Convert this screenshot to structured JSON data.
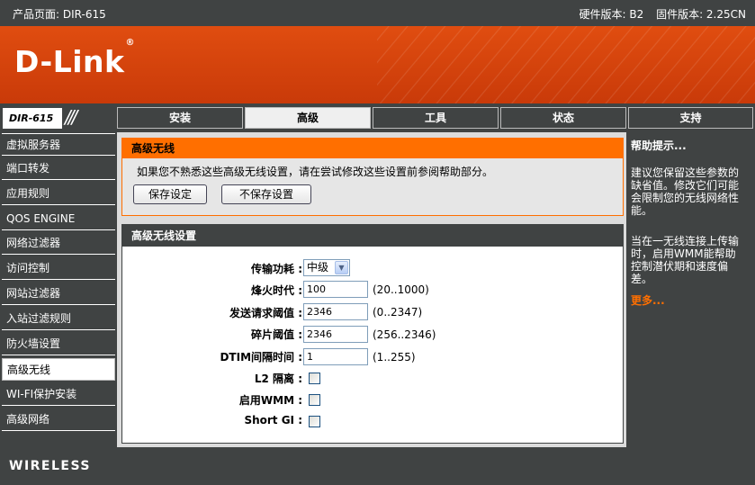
{
  "topbar": {
    "product": "产品页面: DIR-615",
    "hw": "硬件版本: B2",
    "fw": "固件版本: 2.25CN"
  },
  "brand": {
    "logo": "D-Link",
    "model": "DIR-615"
  },
  "tabs": [
    {
      "label": "安装"
    },
    {
      "label": "高级"
    },
    {
      "label": "工具"
    },
    {
      "label": "状态"
    },
    {
      "label": "支持"
    }
  ],
  "sidebar": {
    "items": [
      {
        "label": "虚拟服务器"
      },
      {
        "label": "端口转发"
      },
      {
        "label": "应用规则"
      },
      {
        "label": "QOS ENGINE"
      },
      {
        "label": "网络过滤器"
      },
      {
        "label": "访问控制"
      },
      {
        "label": "网站过滤器"
      },
      {
        "label": "入站过滤规则"
      },
      {
        "label": "防火墙设置"
      },
      {
        "label": "高级无线"
      },
      {
        "label": "WI-FI保护安装"
      },
      {
        "label": "高级网络"
      }
    ]
  },
  "advanced_wireless": {
    "title": "高级无线",
    "description": "如果您不熟悉这些高级无线设置，请在尝试修改这些设置前参阅帮助部分。",
    "save_label": "保存设定",
    "nosave_label": "不保存设置"
  },
  "settings": {
    "title": "高级无线设置",
    "tx_power": {
      "label": "传输功耗 :",
      "value": "中级"
    },
    "beacon": {
      "label": "烽火时代 :",
      "value": "100",
      "range": "(20..1000)"
    },
    "rts": {
      "label": "发送请求阈值 :",
      "value": "2346",
      "range": "(0..2347)"
    },
    "frag": {
      "label": "碎片阈值 :",
      "value": "2346",
      "range": "(256..2346)"
    },
    "dtim": {
      "label": "DTIM间隔时间 :",
      "value": "1",
      "range": "(1..255)"
    },
    "l2": {
      "label": "L2 隔离 :",
      "checked": false
    },
    "wmm": {
      "label": "启用WMM :",
      "checked": false
    },
    "sgi": {
      "label": "Short GI :",
      "checked": false
    }
  },
  "help": {
    "title": "帮助提示...",
    "p1": "建议您保留这些参数的缺省值。修改它们可能会限制您的无线网络性能。",
    "p2": "当在一无线连接上传输时，启用WMM能帮助控制潜伏期和速度偏差。",
    "more": "更多..."
  },
  "footer": {
    "brand": "WIRELESS"
  },
  "colors": {
    "accent": "#ff6f00",
    "dark": "#404343",
    "banner": "#d9460c"
  }
}
